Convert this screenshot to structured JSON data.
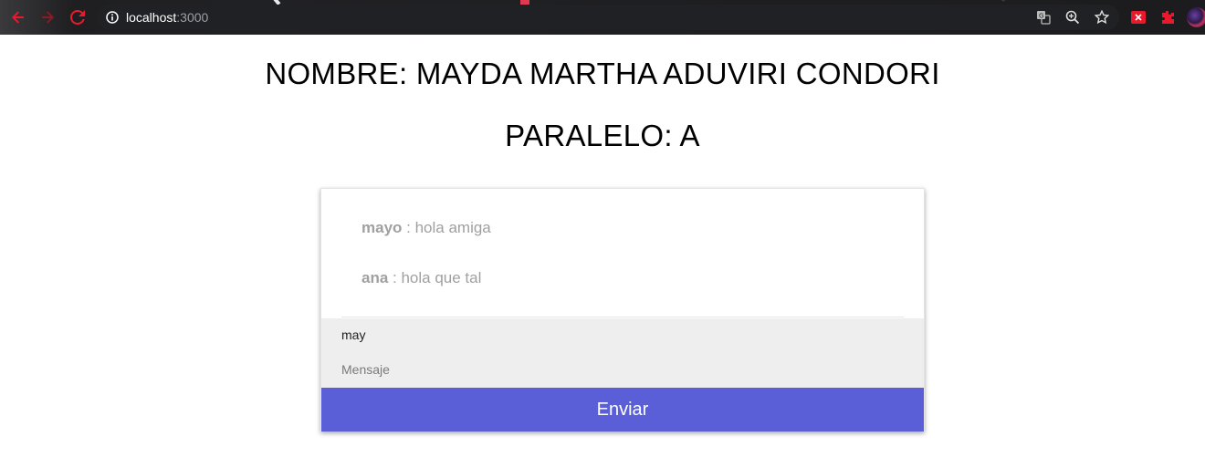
{
  "browser": {
    "url_host": "localhost",
    "url_port": ":3000",
    "icons": {
      "back": "back-arrow-icon",
      "forward": "forward-arrow-icon",
      "reload": "reload-icon",
      "info": "info-icon",
      "translate": "translate-icon",
      "zoom": "zoom-icon",
      "bookmark": "star-icon"
    },
    "accent_color": "#e8192c"
  },
  "page": {
    "nombre": "NOMBRE: MAYDA MARTHA ADUVIRI CONDORI",
    "paralelo": "PARALELO: A"
  },
  "chat": {
    "messages": [
      {
        "user": "mayo",
        "separator": " : ",
        "text": "hola amiga"
      },
      {
        "user": "ana",
        "separator": " : ",
        "text": "hola que tal"
      }
    ],
    "username_value": "may",
    "message_placeholder": "Mensaje",
    "send_label": "Enviar",
    "send_color": "#5a5fd8"
  }
}
